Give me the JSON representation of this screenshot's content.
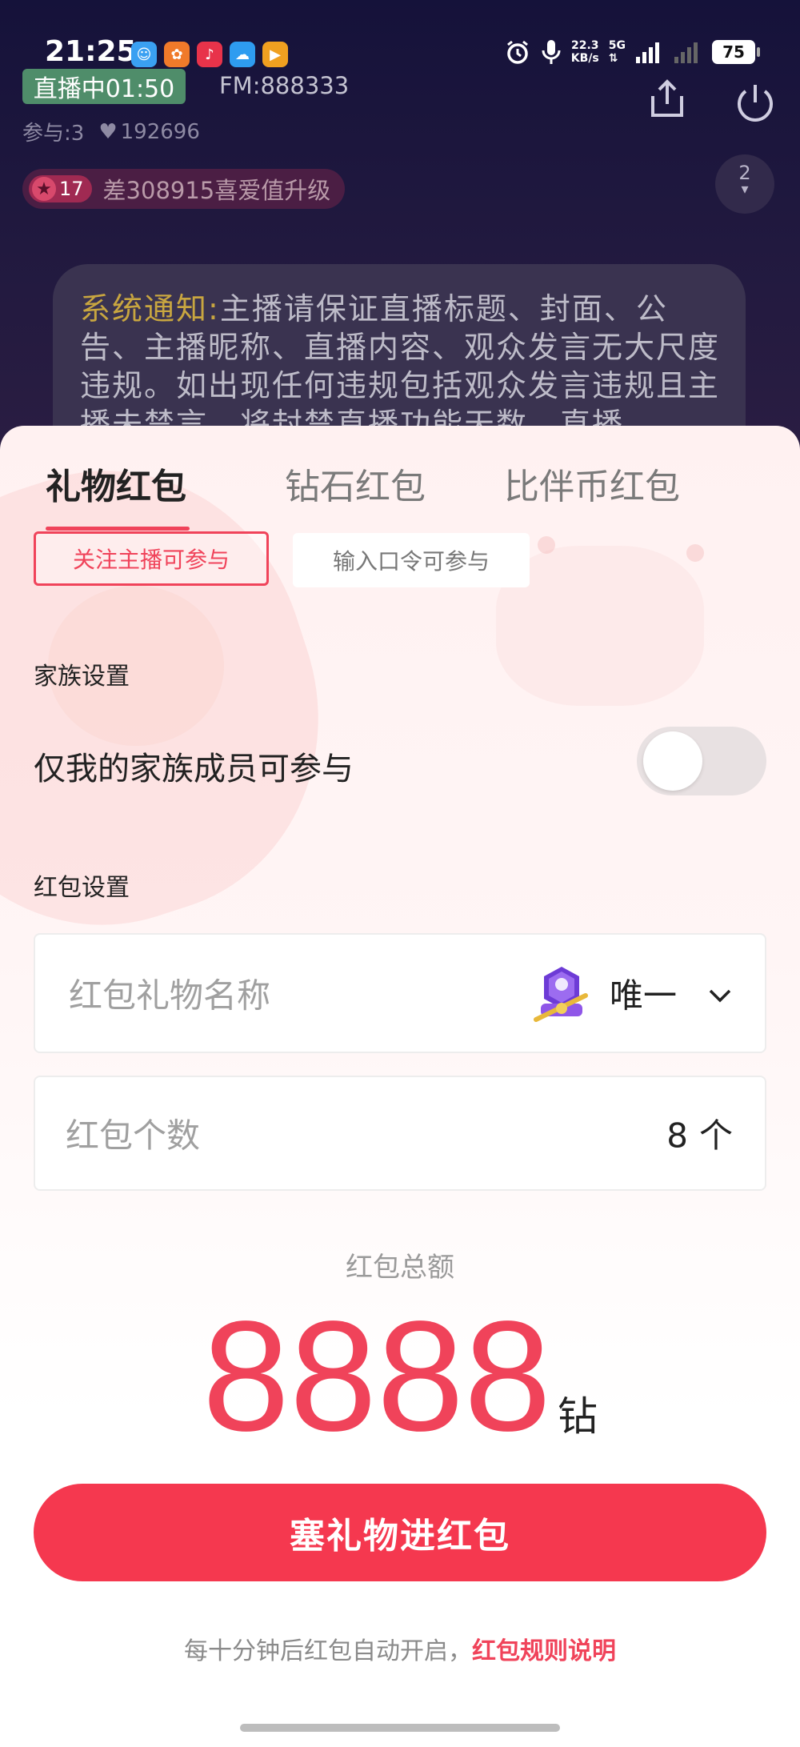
{
  "status_bar": {
    "time": "21:25",
    "net_speed_value": "22.3",
    "net_speed_unit": "KB/s",
    "network": "5G",
    "battery": "75",
    "app_icons": [
      {
        "name": "app-icon-1",
        "color": "#3aa0f2",
        "glyph": "☺"
      },
      {
        "name": "app-icon-2",
        "color": "#f07a2a",
        "glyph": "✿"
      },
      {
        "name": "app-icon-3",
        "color": "#e8334a",
        "glyph": "♪"
      },
      {
        "name": "app-icon-4",
        "color": "#2e9cf0",
        "glyph": "☁"
      },
      {
        "name": "app-icon-5",
        "color": "#f0a020",
        "glyph": "▶"
      }
    ]
  },
  "live_room": {
    "live_badge": "直播中01:50",
    "fm": "FM:888333",
    "participants": "参与:3",
    "likes": "192696",
    "level": "17",
    "upgrade_text": "差308915喜爱值升级",
    "online_count": "2",
    "notice_label": "系统通知:",
    "notice_text": "主播请保证直播标题、封面、公告、主播昵称、直播内容、观众发言无大尺度违规。如出现任何违规包括观众发言违规且主播未禁言，将封禁直播功能天数，直播"
  },
  "sheet": {
    "tabs": [
      "礼物红包",
      "钻石红包",
      "比伴币红包"
    ],
    "active_tab": 0,
    "participation_options": [
      "关注主播可参与",
      "输入口令可参与"
    ],
    "family_section_label": "家族设置",
    "family_only_label": "仅我的家族成员可参与",
    "family_only_enabled": false,
    "packet_section_label": "红包设置",
    "gift_name_placeholder": "红包礼物名称",
    "selected_gift": "唯一",
    "count_placeholder": "红包个数",
    "count_value": "8",
    "count_unit": "个",
    "total_label": "红包总额",
    "total_value": "8888",
    "total_unit": "钻",
    "submit_label": "塞礼物进红包",
    "footer_note": "每十分钟后红包自动开启，",
    "footer_link": "红包规则说明"
  },
  "colors": {
    "accent": "#f0435a",
    "submit_bg": "#f5384f",
    "live_badge_bg": "#4f8d6a",
    "notice_highlight": "#c8a640"
  }
}
